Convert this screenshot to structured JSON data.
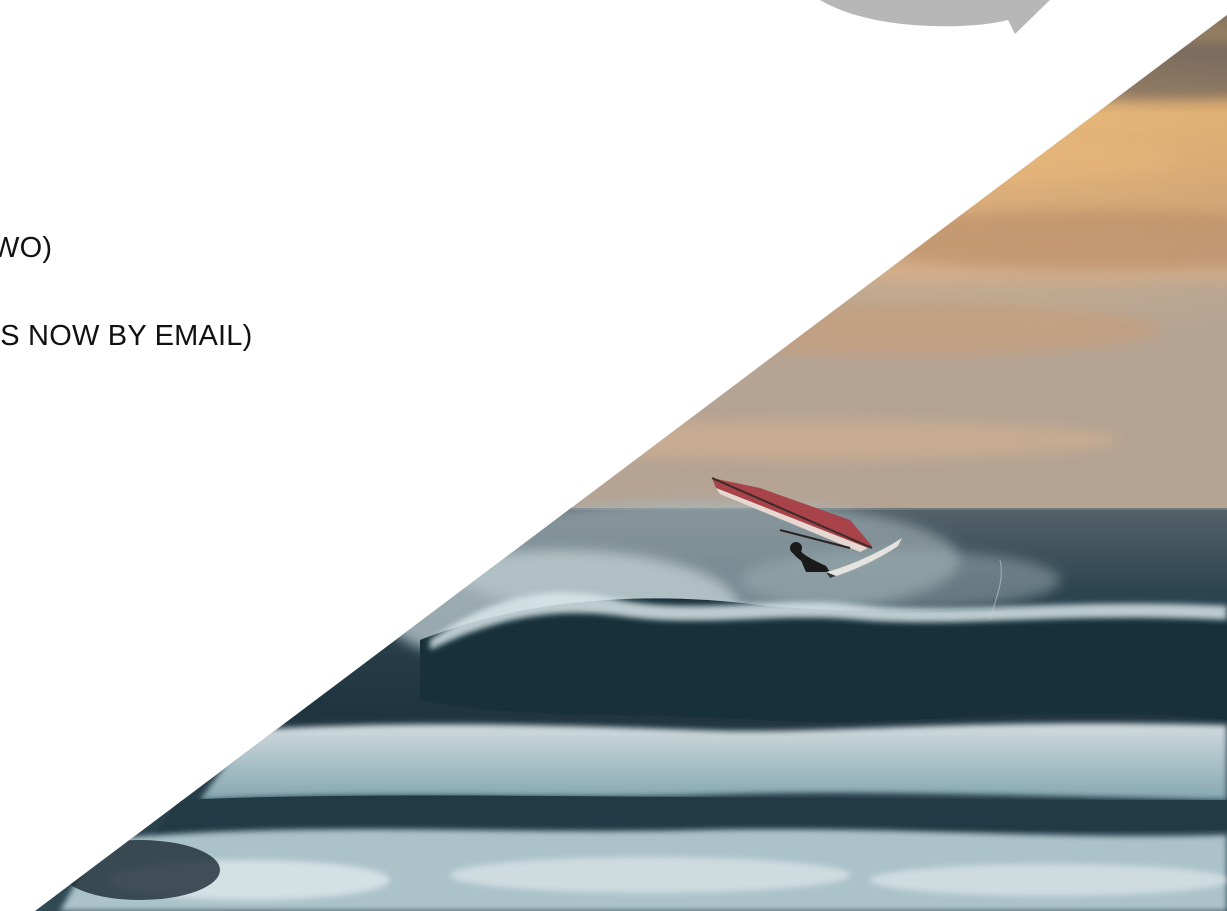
{
  "slide": {
    "lines": [
      "WO)",
      "IS NOW BY EMAIL)"
    ]
  },
  "colors": {
    "callout": "#b7b7b7",
    "sky_top": "#4a4a4d",
    "sky_glow": "#d9a56a",
    "horizon": "#c9a78a",
    "sea_dark": "#1f3440",
    "foam": "#c8dde3"
  },
  "icons": {
    "callout": "speech-bubble-shape"
  }
}
